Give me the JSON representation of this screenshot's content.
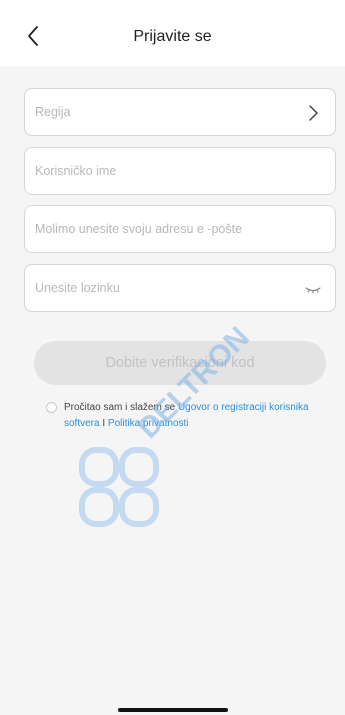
{
  "header": {
    "title": "Prijavite se",
    "back_icon": "chevron-left-icon"
  },
  "form": {
    "region": {
      "placeholder": "Regija",
      "trail_icon": "chevron-right-icon"
    },
    "username": {
      "placeholder": "Korisničko ime"
    },
    "email": {
      "placeholder": "Molimo unesite svoju adresu e -pošte"
    },
    "password": {
      "placeholder": "Unesite lozinku",
      "trail_icon": "eye-closed-icon"
    }
  },
  "button": {
    "get_code_label": "Dobite verifikacioni kod"
  },
  "agreement": {
    "prefix": "Pročitao sam i slažem se ",
    "link_agreement": "Ugovor o registraciji korisnika softvera",
    "separator": " I ",
    "link_privacy": "Politika privatnosti"
  },
  "watermark": {
    "text": "DELTRON"
  },
  "colors": {
    "link": "#2b8fd8",
    "button_bg": "#e3e3e3",
    "background": "#f5f5f5",
    "watermark": "#3e8ed8"
  }
}
